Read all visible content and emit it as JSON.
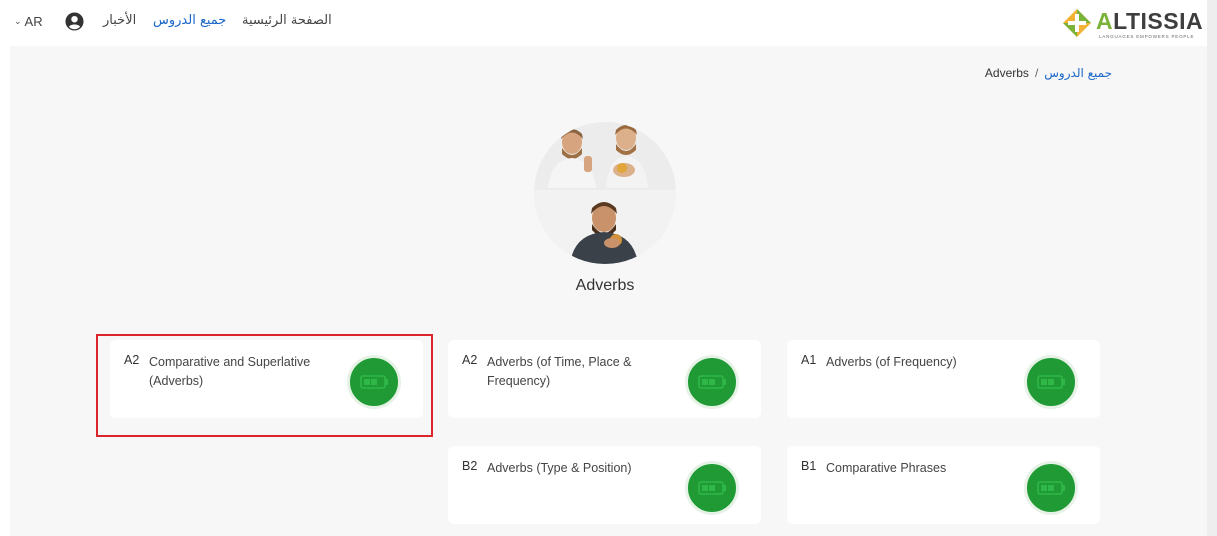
{
  "header": {
    "lang_label": "AR",
    "nav": {
      "news": "الأخبار",
      "all_courses": "جميع الدروس",
      "home": "الصفحة الرئيسية"
    },
    "logo": {
      "wordmark_a": "A",
      "wordmark_rest": "LTISSIA",
      "tagline": "LANGUAGES EMPOWERS PEOPLE"
    }
  },
  "breadcrumb": {
    "parent": "جميع الدروس",
    "separator": "/",
    "current": "Adverbs"
  },
  "topic": {
    "title": "Adverbs"
  },
  "cards": [
    {
      "level": "A2",
      "title": "Comparative and Superlative (Adverbs)",
      "highlighted": true
    },
    {
      "level": "A2",
      "title": "Adverbs (of Time, Place & Frequency)",
      "highlighted": false
    },
    {
      "level": "A1",
      "title": "Adverbs (of Frequency)",
      "highlighted": false
    },
    {
      "level": "B2",
      "title": "Adverbs (Type & Position)",
      "highlighted": false
    },
    {
      "level": "B1",
      "title": "Comparative Phrases",
      "highlighted": false
    }
  ],
  "colors": {
    "accent_link": "#1a66c9",
    "badge_green": "#1f9a34",
    "highlight_red": "#d9252b",
    "logo_green": "#7bb23a"
  },
  "icons": {
    "badge": "battery-icon",
    "user": "user-circle-icon",
    "language": "chevron-down-icon"
  }
}
